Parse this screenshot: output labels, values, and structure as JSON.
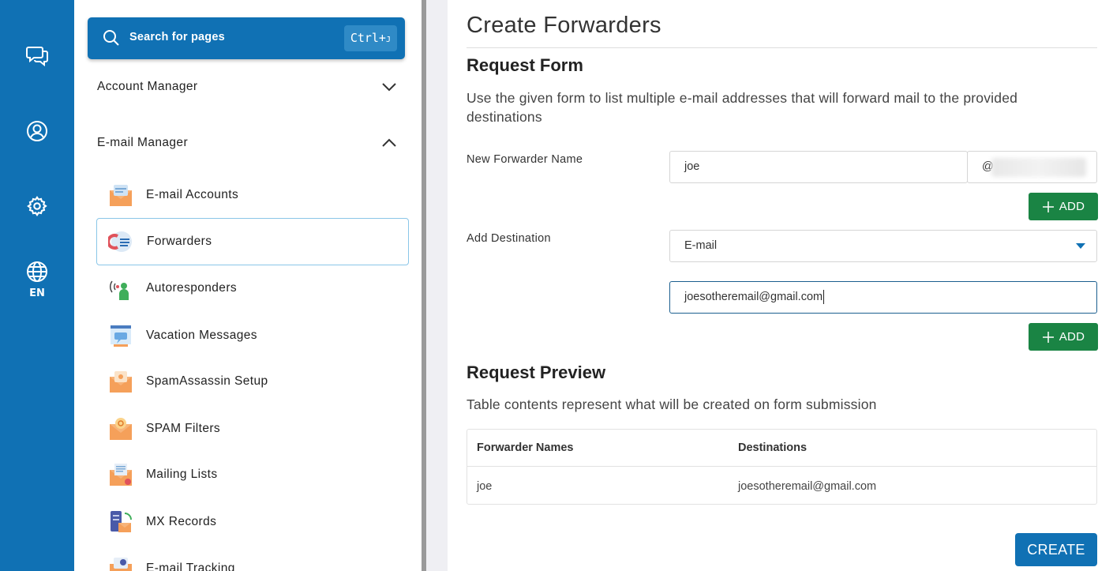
{
  "rail": {
    "items": [
      {
        "name": "chat-icon"
      },
      {
        "name": "user-icon"
      },
      {
        "name": "gear-icon"
      },
      {
        "name": "globe-icon",
        "label": "EN"
      }
    ]
  },
  "sidebar": {
    "search": {
      "label": "Search for pages",
      "shortcut_main": "Ctrl+",
      "shortcut_key": "J"
    },
    "groups": [
      {
        "label": "Account Manager",
        "expanded": false
      },
      {
        "label": "E-mail Manager",
        "expanded": true
      }
    ],
    "items": [
      {
        "label": "E-mail Accounts",
        "icon": "email-accounts-icon"
      },
      {
        "label": "Forwarders",
        "icon": "forwarders-icon",
        "active": true
      },
      {
        "label": "Autoresponders",
        "icon": "autoresponders-icon"
      },
      {
        "label": "Vacation Messages",
        "icon": "vacation-messages-icon"
      },
      {
        "label": "SpamAssassin Setup",
        "icon": "spamassassin-icon"
      },
      {
        "label": "SPAM Filters",
        "icon": "spam-filters-icon"
      },
      {
        "label": "Mailing Lists",
        "icon": "mailing-lists-icon"
      },
      {
        "label": "MX Records",
        "icon": "mx-records-icon"
      },
      {
        "label": "E-mail Tracking",
        "icon": "email-tracking-icon"
      }
    ]
  },
  "main": {
    "title": "Create Forwarders",
    "request_form": {
      "heading": "Request Form",
      "description": "Use the given form to list multiple e-mail addresses that will forward mail to the provided destinations",
      "forwarder_name_label": "New Forwarder Name",
      "forwarder_name_value": "joe",
      "domain_prefix": "@",
      "add_label": "ADD",
      "destination_label": "Add Destination",
      "destination_type": "E-mail",
      "destination_value": "joesotheremail@gmail.com"
    },
    "request_preview": {
      "heading": "Request Preview",
      "description": "Table contents represent what will be created on form submission",
      "columns": [
        "Forwarder Names",
        "Destinations"
      ],
      "rows": [
        [
          "joe",
          "joesotheremail@gmail.com"
        ]
      ]
    },
    "create_label": "CREATE"
  },
  "colors": {
    "brand": "#1071b4",
    "add_button": "#1a8444",
    "splitter": "#9a9a9a"
  }
}
